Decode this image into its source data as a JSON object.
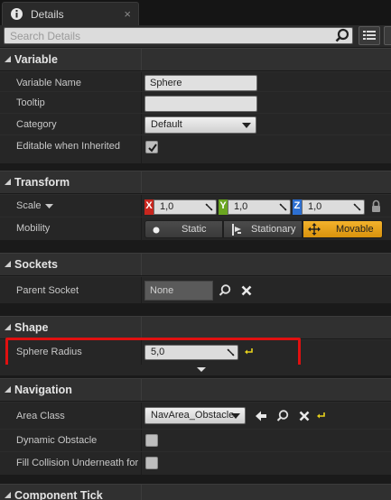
{
  "tab": {
    "title": "Details",
    "icon": "info-icon",
    "close_glyph": "×"
  },
  "search": {
    "placeholder": "Search Details",
    "value": ""
  },
  "categories": {
    "variable": "Variable",
    "transform": "Transform",
    "sockets": "Sockets",
    "shape": "Shape",
    "navigation": "Navigation",
    "component_tick": "Component Tick"
  },
  "variable": {
    "name_label": "Variable Name",
    "name_value": "Sphere",
    "tooltip_label": "Tooltip",
    "tooltip_value": "",
    "category_label": "Category",
    "category_value": "Default",
    "editable_label": "Editable when Inherited",
    "editable_checked": true
  },
  "transform": {
    "scale_label": "Scale",
    "x_tag": "X",
    "x_value": "1,0",
    "y_tag": "Y",
    "y_value": "1,0",
    "z_tag": "Z",
    "z_value": "1,0",
    "mobility_label": "Mobility",
    "mobility_options": [
      "Static",
      "Stationary",
      "Movable"
    ],
    "mobility_selected": "Movable"
  },
  "sockets": {
    "parent_socket_label": "Parent Socket",
    "parent_socket_value": "None"
  },
  "shape": {
    "sphere_radius_label": "Sphere Radius",
    "sphere_radius_value": "5,0"
  },
  "navigation": {
    "area_class_label": "Area Class",
    "area_class_value": "NavArea_Obstacle",
    "dynamic_obstacle_label": "Dynamic Obstacle",
    "fill_collision_label": "Fill Collision Underneath for"
  },
  "colors": {
    "accent": "#f0a81c",
    "x_axis": "#c8261e",
    "y_axis": "#6aa520",
    "z_axis": "#2d6fd1",
    "highlight": "#e01010"
  }
}
